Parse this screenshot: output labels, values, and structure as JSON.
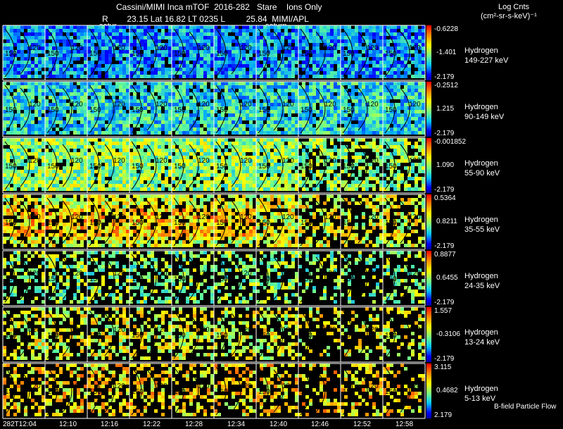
{
  "header": {
    "title": "Cassini/MIMI Inca mTOF  2016-282   Stare    Ions Only",
    "subtitle": "R        23.15 Lat 16.82 LT 0235 L         25.84  MIMI/APL",
    "saturn_label_1": "satur",
    "saturn_label_2": "saturn",
    "units_label_1": "Log Cnts",
    "units_label_2": "(cm²-sr-s-keV)⁻¹"
  },
  "bands": [
    {
      "species": "Hydrogen",
      "energy": "149-227 keV",
      "cb_max": "-0.6228",
      "cb_mid": "-1.401",
      "cb_min": "-2.179",
      "intensity": 0.3
    },
    {
      "species": "Hydrogen",
      "energy": "90-149 keV",
      "cb_max": "-0.2512",
      "cb_mid": "1.215",
      "cb_min": "-2.179",
      "intensity": 0.4
    },
    {
      "species": "Hydrogen",
      "energy": "55-90 keV",
      "cb_max": "-0.001852",
      "cb_mid": "1.090",
      "cb_min": "-2.179",
      "intensity": 0.55
    },
    {
      "species": "Hydrogen",
      "energy": "35-55 keV",
      "cb_max": "0.5364",
      "cb_mid": "0.8211",
      "cb_min": "-2.179",
      "intensity": 0.65
    },
    {
      "species": "Hydrogen",
      "energy": "24-35 keV",
      "cb_max": "0.8877",
      "cb_mid": "0.6455",
      "cb_min": "-2.179",
      "intensity": 0.55
    },
    {
      "species": "Hydrogen",
      "energy": "13-24 keV",
      "cb_max": "1.557",
      "cb_mid": "-0.3106",
      "cb_min": "-2.179",
      "intensity": 0.65
    },
    {
      "species": "Hydrogen",
      "energy": "5-13 keV",
      "cb_max": "3.115",
      "cb_mid": "0.4682",
      "cb_min": "2.179",
      "intensity": 0.72
    }
  ],
  "contour_labels": [
    "150",
    "120"
  ],
  "footer": {
    "bfield_label": "B-field Particle Flow",
    "times": [
      "282T12:04",
      "12:10",
      "12:16",
      "12:22",
      "12:28",
      "12:34",
      "12:40",
      "12:46",
      "12:52",
      "12:58"
    ]
  }
}
